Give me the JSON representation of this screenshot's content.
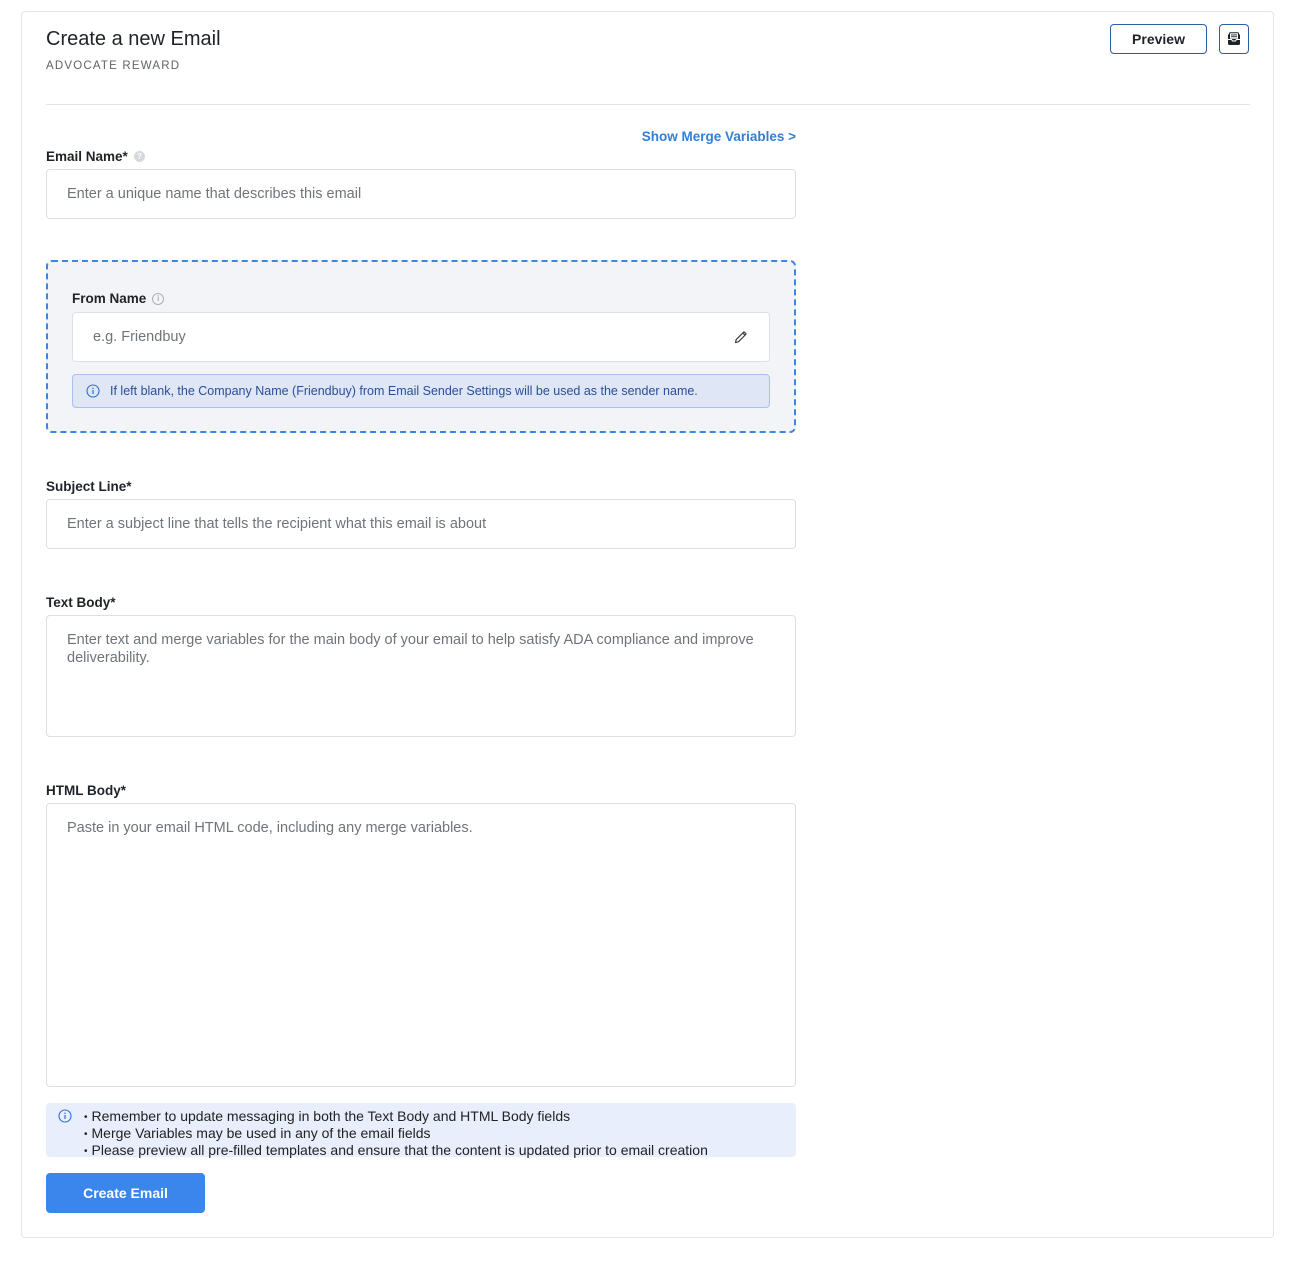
{
  "header": {
    "title": "Create a new Email",
    "subtitle": "ADVOCATE REWARD",
    "preview_label": "Preview",
    "inbox_icon": "inbox-icon"
  },
  "merge_link": "Show Merge Variables >",
  "email_name": {
    "label": "Email Name*",
    "help_icon": "?",
    "placeholder": "Enter a unique name that describes this email"
  },
  "from_name": {
    "label": "From Name",
    "info_icon": "i",
    "placeholder": "e.g. Friendbuy",
    "notice": "If left blank, the Company Name (Friendbuy) from Email Sender Settings will be used as the sender name."
  },
  "subject_line": {
    "label": "Subject Line*",
    "placeholder": "Enter a subject line that tells the recipient what this email is about"
  },
  "text_body": {
    "label": "Text Body*",
    "placeholder": "Enter text and merge variables for the main body of your email to help satisfy ADA compliance and improve deliverability."
  },
  "html_body": {
    "label": "HTML Body*",
    "placeholder": "Paste in your email HTML code, including any merge variables."
  },
  "notes": [
    "Remember to update messaging in both the Text Body and HTML Body fields",
    "Merge Variables may be used in any of the email fields",
    "Please preview all pre-filled templates and ensure that the content is updated prior to email creation"
  ],
  "create_label": "Create Email",
  "colors": {
    "primary": "#3a86ec",
    "link": "#2f80d9",
    "dashed_border": "#3b86e0",
    "notice_bg": "#dfe6f6"
  }
}
